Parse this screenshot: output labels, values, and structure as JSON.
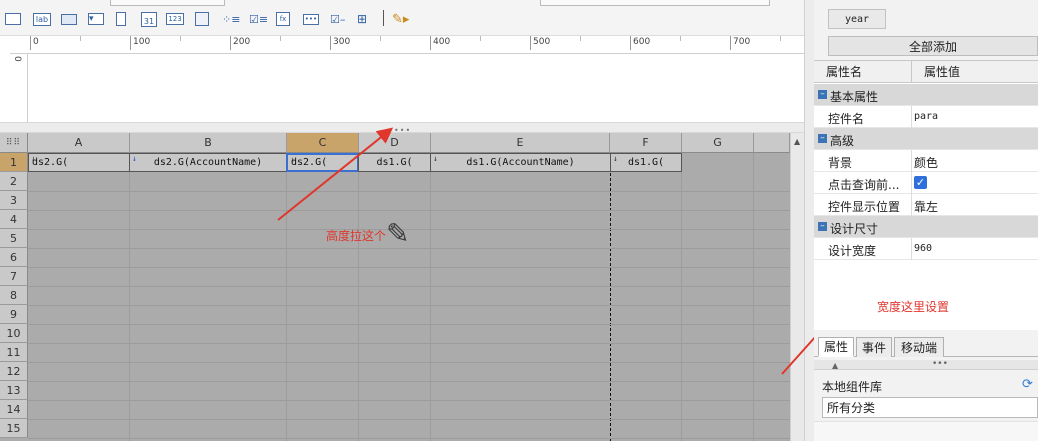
{
  "grid": {
    "columns": [
      "A",
      "B",
      "C",
      "D",
      "E",
      "F",
      "G"
    ],
    "rows": [
      "1",
      "2",
      "3",
      "4",
      "5",
      "6",
      "7",
      "8",
      "9",
      "10",
      "11",
      "12",
      "13",
      "14",
      "15"
    ],
    "cells": {
      "a1": "ds2.G(",
      "b1": "ds2.G(AccountName)",
      "c1": "ds2.G(",
      "d1": "ds1.G(",
      "e1": "ds1.G(AccountName)",
      "f1": "ds1.G("
    }
  },
  "ruler": {
    "labels": [
      "0",
      "100",
      "200",
      "300",
      "400",
      "500",
      "600",
      "700"
    ],
    "vertical": "0"
  },
  "annotations": {
    "height_note": "高度拉这个",
    "width_note": "宽度这里设置",
    "color": "#e0362c"
  },
  "right_panel": {
    "param_chip": "year",
    "add_all_button": "全部添加",
    "prop_headers": {
      "name": "属性名",
      "value": "属性值"
    },
    "groups": {
      "basic": "基本属性",
      "advanced": "高级",
      "design_size": "设计尺寸"
    },
    "props": {
      "widget_name": {
        "name": "控件名",
        "value": "para"
      },
      "background": {
        "name": "背景",
        "value": "颜色"
      },
      "click_query": {
        "name": "点击查询前...",
        "checked": true
      },
      "display_position": {
        "name": "控件显示位置",
        "value": "靠左"
      },
      "design_width": {
        "name": "设计宽度",
        "value": "960"
      }
    },
    "tabs": [
      "属性",
      "事件",
      "移动端"
    ],
    "library_title": "本地组件库",
    "library_select": "所有分类"
  }
}
